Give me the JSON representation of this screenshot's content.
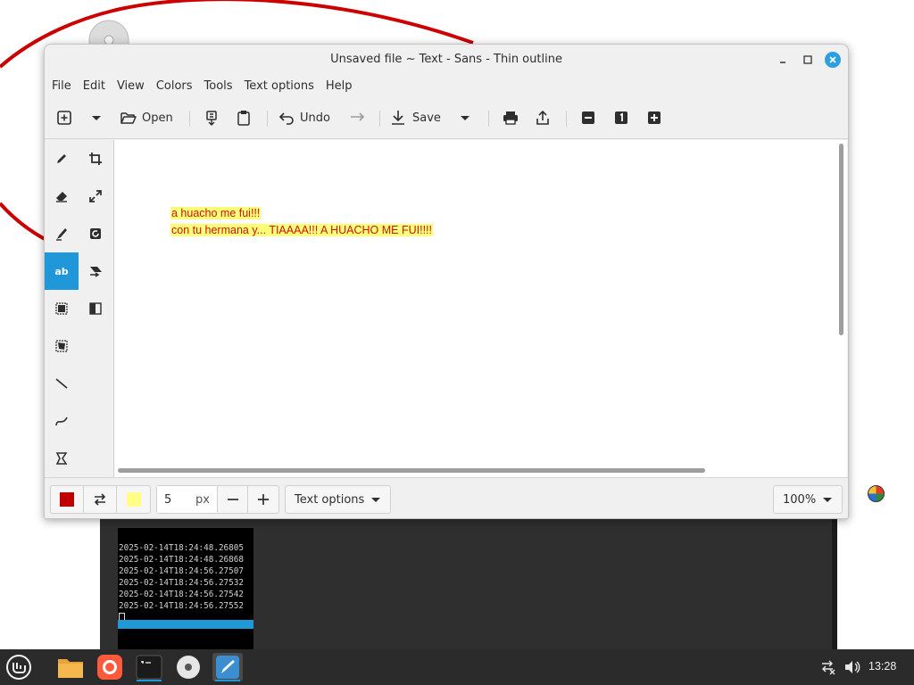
{
  "window": {
    "title": "Unsaved file ~ Text - Sans - Thin outline"
  },
  "menu": [
    "File",
    "Edit",
    "View",
    "Colors",
    "Tools",
    "Text options",
    "Help"
  ],
  "toolbar": {
    "new_icon": "new-document-icon",
    "open_label": "Open",
    "undo_label": "Undo",
    "save_label": "Save"
  },
  "canvas": {
    "text_lines": [
      "a huacho me fui!!!",
      "con tu hermana y... TIAAAA!!! A HUACHO ME FUI!!!!"
    ],
    "text_color": "#c81515",
    "highlight_color": "#ffff77"
  },
  "bottom_bar": {
    "primary_color": "#c00000",
    "secondary_color": "#ffff88",
    "size_value": "5",
    "size_unit": "px",
    "text_options_label": "Text options",
    "zoom_label": "100%"
  },
  "terminal": {
    "lines": [
      "2025-02-14T18:24:48.26805",
      "2025-02-14T18:24:48.26868",
      "2025-02-14T18:24:56.27507",
      "2025-02-14T18:24:56.27532",
      "2025-02-14T18:24:56.27542",
      "2025-02-14T18:24:56.27552"
    ]
  },
  "taskbar": {
    "clock": "13:28",
    "accent_color": "#1f97d9"
  }
}
